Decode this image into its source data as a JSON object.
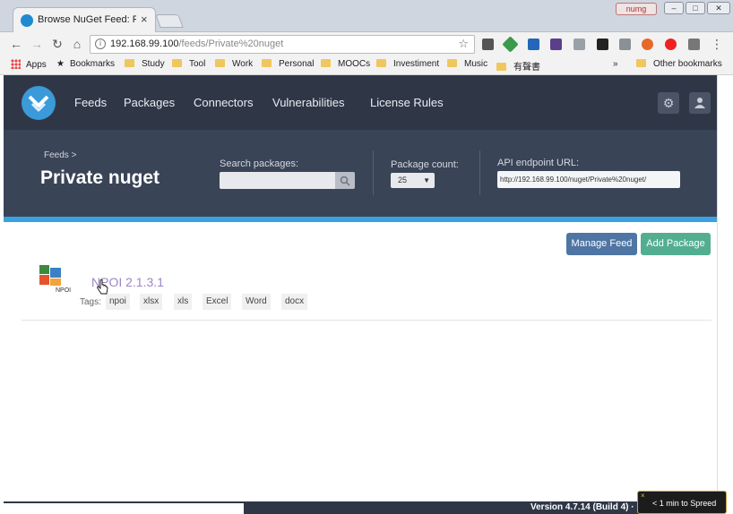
{
  "browser": {
    "tab_title": "Browse NuGet Feed: Priv",
    "tab_close": "×",
    "user_label": "numg",
    "window_controls": [
      "–",
      "□",
      "✕"
    ],
    "address": {
      "host": "192.168.99.100",
      "path": "/feeds/Private%20nuget"
    },
    "bookmarks": [
      {
        "label": "Apps",
        "type": "apps"
      },
      {
        "label": "Bookmarks",
        "type": "star"
      },
      {
        "label": "Study",
        "type": "folder"
      },
      {
        "label": "Tool",
        "type": "folder"
      },
      {
        "label": "Work",
        "type": "folder"
      },
      {
        "label": "Personal",
        "type": "folder"
      },
      {
        "label": "MOOCs",
        "type": "folder"
      },
      {
        "label": "Investiment",
        "type": "folder"
      },
      {
        "label": "Music",
        "type": "folder"
      },
      {
        "label": "有聲書",
        "type": "folder"
      }
    ],
    "overflow": "»",
    "other_bookmarks": "Other bookmarks"
  },
  "nav": {
    "links": [
      "Feeds",
      "Packages",
      "Connectors",
      "Vulnerabilities",
      "License Rules"
    ]
  },
  "header": {
    "breadcrumb": "Feeds >",
    "title": "Private nuget",
    "search_label": "Search packages:",
    "count_label": "Package count:",
    "count_value": "25",
    "api_label": "API endpoint URL:",
    "api_url": "http://192.168.99.100/nuget/Private%20nuget/"
  },
  "actions": {
    "manage_feed": "Manage Feed",
    "add_package": "Add Package"
  },
  "package": {
    "icon_text": "NPOI",
    "name": "NPOI 2.1.3.1",
    "tags_label": "Tags:",
    "tags": [
      "npoi",
      "xlsx",
      "xls",
      "Excel",
      "Word",
      "docx"
    ]
  },
  "footer": {
    "version": "Version 4.7.14 (Build 4) ·"
  },
  "toast": {
    "text": "< 1 min to Spreed",
    "close": "×"
  },
  "colors": {
    "nav_bg": "#2f3747",
    "header_bg": "#3a4457",
    "accent": "#3aa1e3",
    "manage_btn": "#4e75a3",
    "add_btn": "#53ae91",
    "package_link": "#9c86c4"
  }
}
